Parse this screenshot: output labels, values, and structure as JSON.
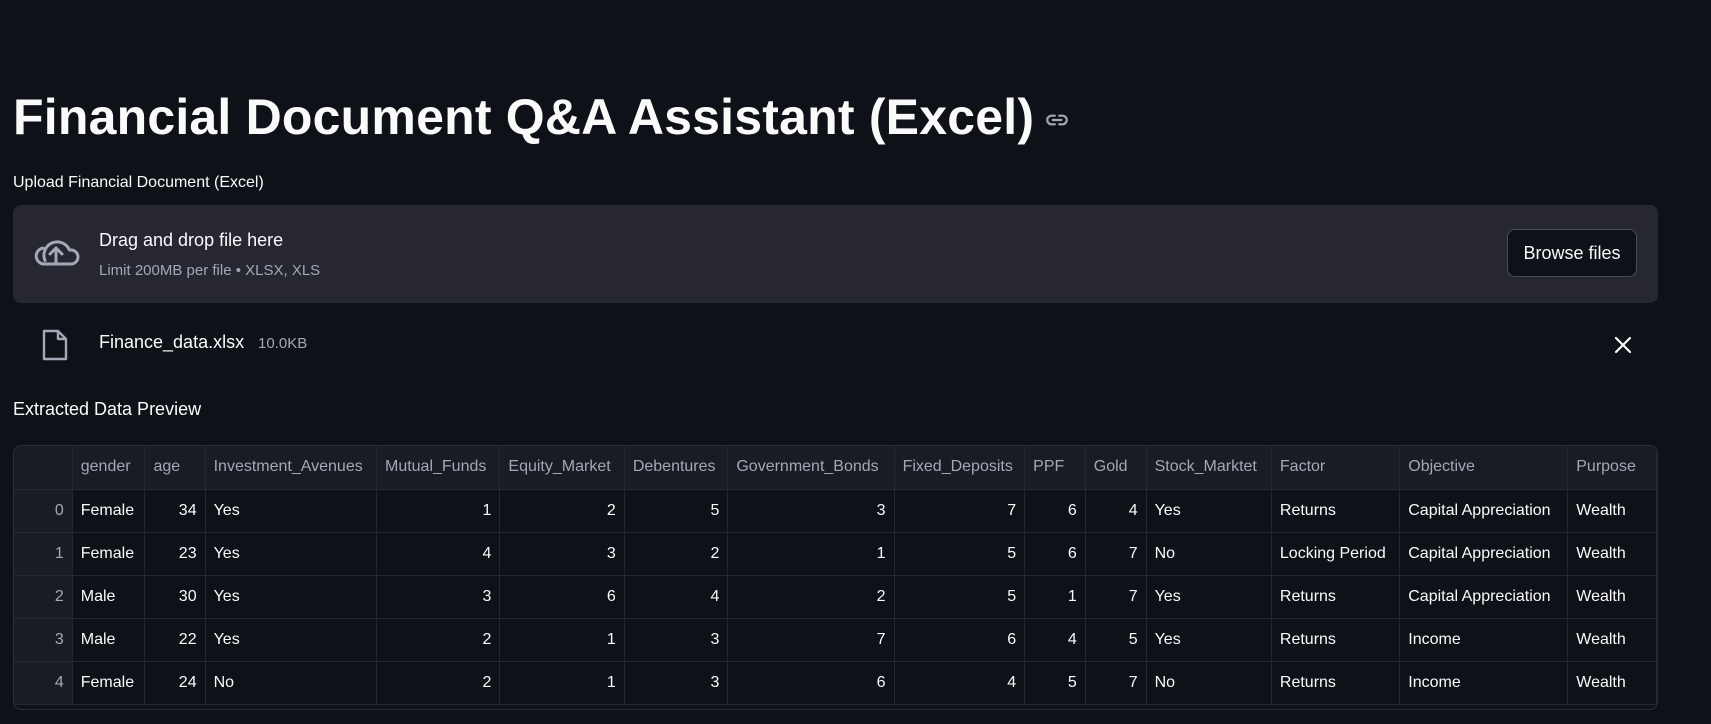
{
  "header": {
    "title": "Financial Document Q&A Assistant (Excel)",
    "link_icon": "link-icon"
  },
  "uploader": {
    "label": "Upload Financial Document (Excel)",
    "drop_text": "Drag and drop file here",
    "limit_text": "Limit 200MB per file • XLSX, XLS",
    "browse_label": "Browse files",
    "icon": "cloud-upload-icon"
  },
  "uploaded_file": {
    "name": "Finance_data.xlsx",
    "size": "10.0KB",
    "icon": "file-icon",
    "remove_icon": "close-icon"
  },
  "preview": {
    "label": "Extracted Data Preview",
    "columns": [
      "",
      "gender",
      "age",
      "Investment_Avenues",
      "Mutual_Funds",
      "Equity_Market",
      "Debentures",
      "Government_Bonds",
      "Fixed_Deposits",
      "PPF",
      "Gold",
      "Stock_Marktet",
      "Factor",
      "Objective",
      "Purpose"
    ],
    "rows": [
      [
        "0",
        "Female",
        "34",
        "Yes",
        "1",
        "2",
        "5",
        "3",
        "7",
        "6",
        "4",
        "Yes",
        "Returns",
        "Capital Appreciation",
        "Wealth"
      ],
      [
        "1",
        "Female",
        "23",
        "Yes",
        "4",
        "3",
        "2",
        "1",
        "5",
        "6",
        "7",
        "No",
        "Locking Period",
        "Capital Appreciation",
        "Wealth"
      ],
      [
        "2",
        "Male",
        "30",
        "Yes",
        "3",
        "6",
        "4",
        "2",
        "5",
        "1",
        "7",
        "Yes",
        "Returns",
        "Capital Appreciation",
        "Wealth"
      ],
      [
        "3",
        "Male",
        "22",
        "Yes",
        "2",
        "1",
        "3",
        "7",
        "6",
        "4",
        "5",
        "Yes",
        "Returns",
        "Income",
        "Wealth"
      ],
      [
        "4",
        "Female",
        "24",
        "No",
        "2",
        "1",
        "3",
        "6",
        "4",
        "5",
        "7",
        "No",
        "Returns",
        "Income",
        "Wealth"
      ]
    ]
  }
}
